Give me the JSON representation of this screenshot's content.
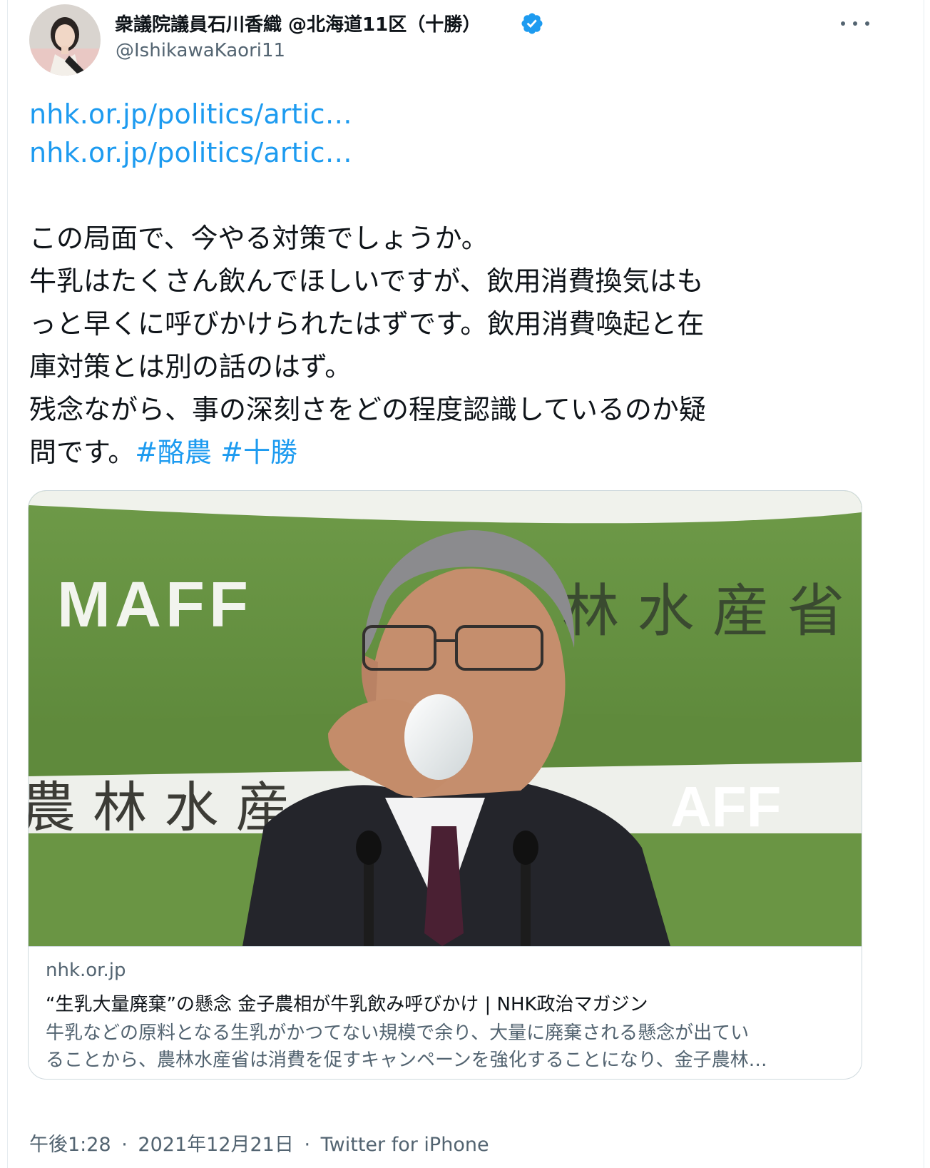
{
  "author": {
    "display_name": "衆議院議員石川香織 @北海道11区（十勝）",
    "handle": "@IshikawaKaori11",
    "verified_icon": "verified-badge-icon"
  },
  "links": [
    "nhk.or.jp/politics/artic…",
    "nhk.or.jp/politics/artic…"
  ],
  "body_lines": [
    "この局面で、今やる対策でしょうか。",
    "牛乳はたくさん飲んでほしいですが、飲用消費換気はも",
    "っと早くに呼びかけられたはずです。飲用消費喚起と在",
    "庫対策とは別の話のはず。",
    "残念ながら、事の深刻さをどの程度認識しているのか疑"
  ],
  "body_last_line": "問です。",
  "hashtags": [
    "#酪農",
    "#十勝"
  ],
  "card": {
    "image_texts": {
      "top_logo": "MAFF",
      "top_kanji": "林 水 産 省",
      "bottom_kanji": "農 林 水 産",
      "bottom_logo": "AFF"
    },
    "domain": "nhk.or.jp",
    "title": "“生乳大量廃棄”の懸念 金子農相が牛乳飲み呼びかけ | NHK政治マガジン",
    "description_lines": [
      "牛乳などの原料となる生乳がかつてない規模で余り、大量に廃棄される懸念が出てい",
      "ることから、農林水産省は消費を促すキャンペーンを強化することになり、金子農林…"
    ]
  },
  "footer": {
    "time": "午後1:28",
    "date": "2021年12月21日",
    "source": "Twitter for iPhone",
    "separator": "·"
  },
  "colors": {
    "link": "#1d9bf0",
    "text": "#0f1419",
    "secondary": "#536471",
    "maff_green": "#6f9a49"
  }
}
